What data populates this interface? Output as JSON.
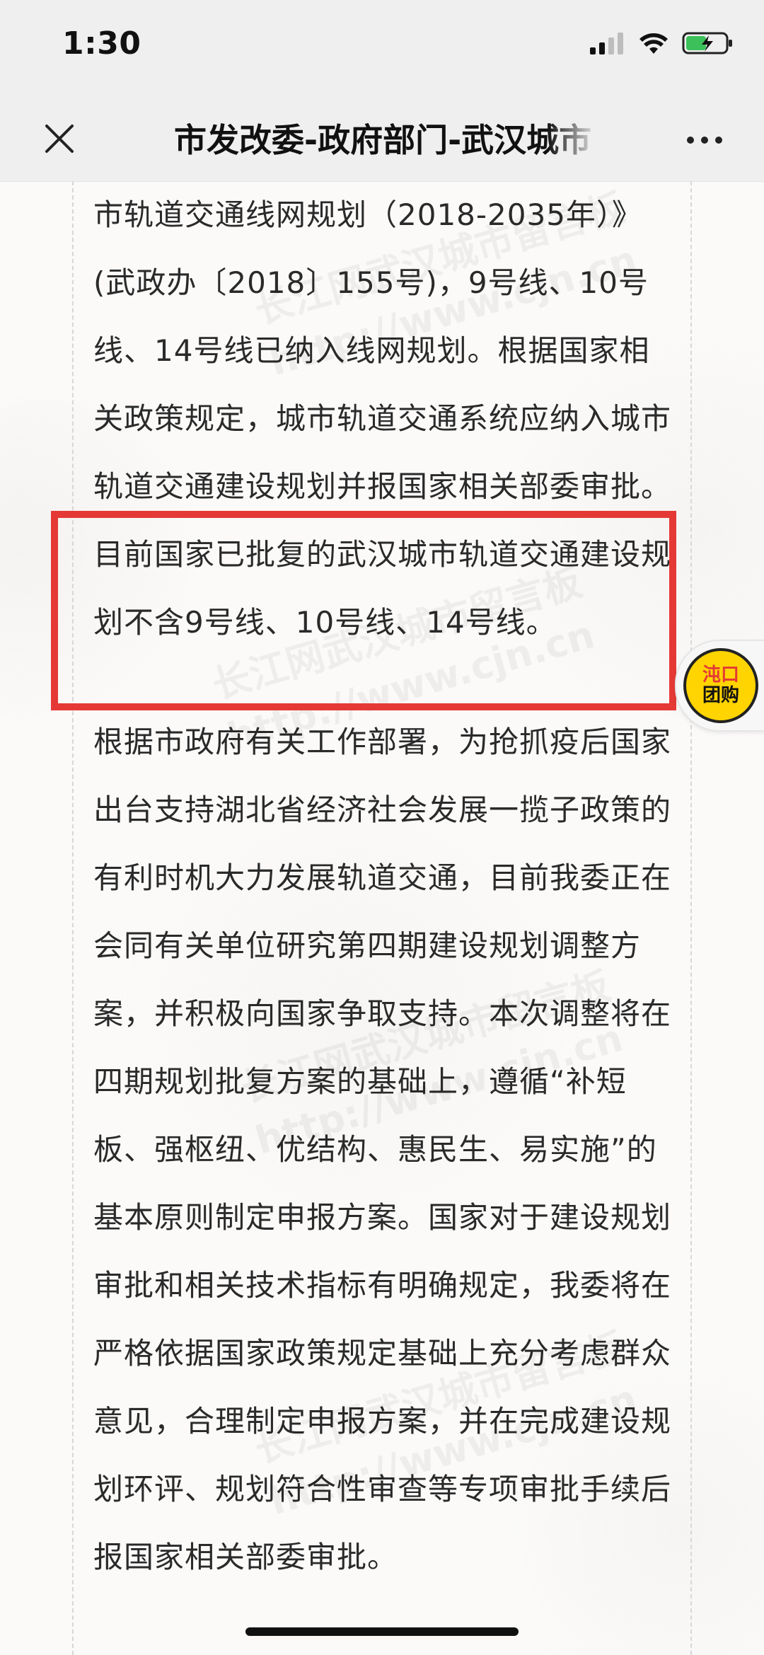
{
  "status_bar": {
    "time": "1:30",
    "icons": [
      "signal-icon",
      "wifi-icon",
      "battery-charging-icon"
    ],
    "battery_color": "#3bc05a"
  },
  "nav": {
    "title": "市发改委-政府部门-武汉城市",
    "close_icon": "close-icon",
    "more_icon": "more-icon"
  },
  "content": {
    "paragraph_1": "市轨道交通线网规划（2018-2035年）》(武政办〔2018〕155号)，9号线、10号线、14号线已纳入线网规划。根据国家相关政策规定，城市轨道交通系统应纳入城市轨道交通建设规划并报国家相关部委审批。目前国家已批复的武汉城市轨道交通建设规划不含9号线、10号线、14号线。",
    "paragraph_2": "根据市政府有关工作部署，为抢抓疫后国家出台支持湖北省经济社会发展一揽子政策的有利时机大力发展轨道交通，目前我委正在会同有关单位研究第四期建设规划调整方案，并积极向国家争取支持。本次调整将在四期规划批复方案的基础上，遵循“补短板、强枢纽、优结构、惠民生、易实施”的基本原则制定申报方案。国家对于建设规划审批和相关技术指标有明确规定，我委将在严格依据国家政策规定基础上充分考虑群众意见，合理制定申报方案，并在完成建设规划环评、规划符合性审查等专项审批手续后报国家相关部委审批。"
  },
  "watermark": {
    "line_1": "长江网武汉城市留言板",
    "line_2": "http://www.cjn.cn"
  },
  "float_badge": {
    "line_1": "沌口",
    "line_2": "团购",
    "accent_color": "#ffd400"
  },
  "highlight": {
    "color": "#e53935"
  }
}
